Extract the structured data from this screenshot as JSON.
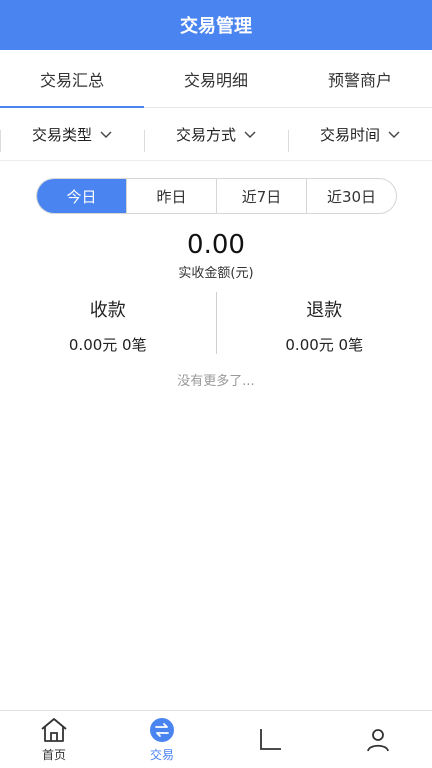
{
  "header": {
    "title": "交易管理"
  },
  "tabs": [
    {
      "label": "交易汇总"
    },
    {
      "label": "交易明细"
    },
    {
      "label": "预警商户"
    }
  ],
  "filters": [
    {
      "label": "交易类型"
    },
    {
      "label": "交易方式"
    },
    {
      "label": "交易时间"
    }
  ],
  "periods": [
    {
      "label": "今日"
    },
    {
      "label": "昨日"
    },
    {
      "label": "近7日"
    },
    {
      "label": "近30日"
    }
  ],
  "summary": {
    "amount": "0.00",
    "label": "实收金额(元)"
  },
  "receive": {
    "title": "收款",
    "value": "0.00元 0笔"
  },
  "refund": {
    "title": "退款",
    "value": "0.00元 0笔"
  },
  "no_more": "没有更多了...",
  "nav": [
    {
      "label": "首页"
    },
    {
      "label": "交易"
    },
    {
      "label": ""
    },
    {
      "label": ""
    }
  ],
  "colors": {
    "accent": "#4a84f0"
  }
}
